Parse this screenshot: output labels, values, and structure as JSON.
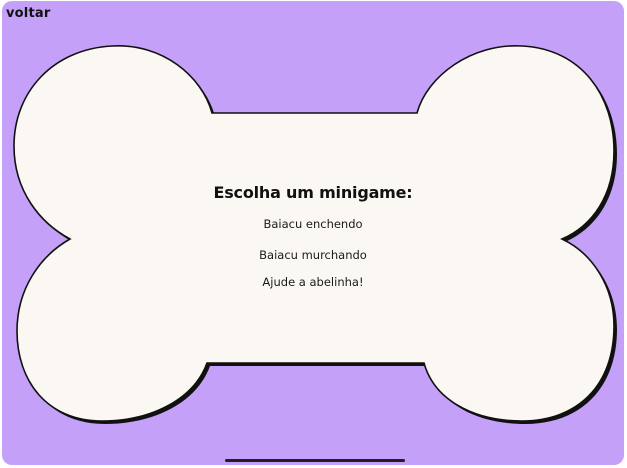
{
  "nav": {
    "back_label": "voltar"
  },
  "menu": {
    "title": "Escolha um minigame:",
    "items": [
      {
        "label": "Baiacu enchendo"
      },
      {
        "label": "Baiacu murchando"
      },
      {
        "label": "Ajude a abelinha!"
      }
    ]
  },
  "colors": {
    "background": "#c4a0f8",
    "bone_fill": "#fbf8f3",
    "outline": "#111111"
  }
}
